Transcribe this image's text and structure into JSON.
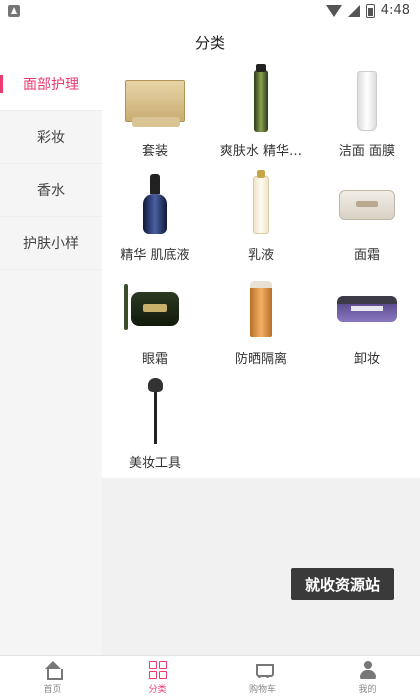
{
  "status_bar": {
    "time": "4:48"
  },
  "header": {
    "title": "分类"
  },
  "sidebar": {
    "items": [
      {
        "label": "面部护理",
        "active": true
      },
      {
        "label": "彩妆",
        "active": false
      },
      {
        "label": "香水",
        "active": false
      },
      {
        "label": "护肤小样",
        "active": false
      }
    ]
  },
  "categories": [
    {
      "label": "套装",
      "icon": "gift-set-icon"
    },
    {
      "label": "爽肤水 精华…",
      "icon": "toner-bottle-icon"
    },
    {
      "label": "洁面 面膜",
      "icon": "cleanser-tube-icon"
    },
    {
      "label": "精华 肌底液",
      "icon": "serum-bottle-icon"
    },
    {
      "label": "乳液",
      "icon": "lotion-bottle-icon"
    },
    {
      "label": "面霜",
      "icon": "cream-jar-icon"
    },
    {
      "label": "眼霜",
      "icon": "eye-cream-jar-icon"
    },
    {
      "label": "防晒隔离",
      "icon": "sunscreen-bottle-icon"
    },
    {
      "label": "卸妆",
      "icon": "cleansing-balm-icon"
    },
    {
      "label": "美妆工具",
      "icon": "makeup-brush-icon"
    }
  ],
  "watermark": {
    "text": "就收资源站"
  },
  "tabbar": {
    "tabs": [
      {
        "label": "首页",
        "icon": "home-icon",
        "active": false
      },
      {
        "label": "分类",
        "icon": "category-grid-icon",
        "active": true
      },
      {
        "label": "购物车",
        "icon": "cart-icon",
        "active": false
      },
      {
        "label": "我的",
        "icon": "user-icon",
        "active": false
      }
    ]
  },
  "colors": {
    "accent": "#ee3a6f",
    "sidebar_bg": "#f5f5f5",
    "main_bg": "#f1f1f1"
  }
}
